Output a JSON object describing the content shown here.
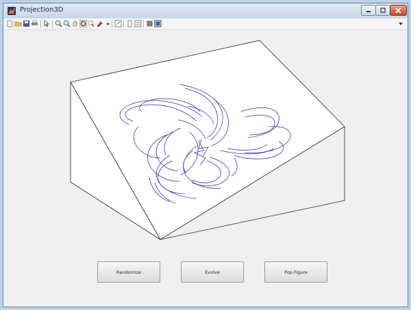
{
  "window": {
    "title": "Projection3D"
  },
  "toolbar": {
    "icons": [
      "new-figure-icon",
      "open-file-icon",
      "save-icon",
      "print-icon",
      "edit-plot-icon",
      "zoom-in-icon",
      "zoom-out-icon",
      "pan-icon",
      "rotate-3d-icon",
      "data-cursor-icon",
      "brush-icon",
      "link-plot-icon",
      "colorbar-icon",
      "legend-icon",
      "hide-plot-tools-icon",
      "show-plot-tools-icon"
    ]
  },
  "buttons": {
    "randomize": "Randomize",
    "evolve": "Evolve",
    "pop_figure": "Pop Figure"
  },
  "colors": {
    "trajectory": "#2a2ab8",
    "surface": "#ffffff",
    "background": "#f0f0f0"
  }
}
